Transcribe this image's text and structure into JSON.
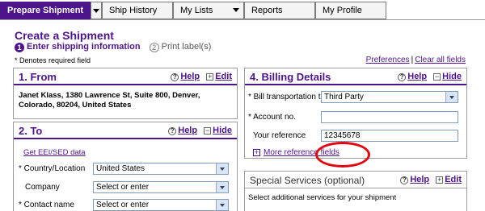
{
  "tabs": [
    {
      "label": "Prepare Shipment"
    },
    {
      "label": "Ship History"
    },
    {
      "label": "My Lists"
    },
    {
      "label": "Reports"
    },
    {
      "label": "My Profile"
    }
  ],
  "page": {
    "title": "Create a Shipment",
    "steps": [
      {
        "num": "1",
        "label": "Enter shipping information"
      },
      {
        "num": "2",
        "label": "Print label(s)"
      }
    ],
    "required_note": "* Denotes required field",
    "preferences_link": "Preferences",
    "separator": "|",
    "clear_all_link": "Clear all fields"
  },
  "from_panel": {
    "title": "1. From",
    "help": "Help",
    "edit": "Edit",
    "address": "Janet Klass, 1380 Lawrence St, Suite 800, Denver, Colorado, 80204, United States"
  },
  "to_panel": {
    "title": "2. To",
    "help": "Help",
    "hide": "Hide",
    "eei_link": "Get EEI/SED data",
    "country_label": "* Country/Location",
    "country_value": "United States",
    "company_label": "Company",
    "company_value": "Select or enter",
    "contact_label": "* Contact name",
    "contact_value": "Select or enter"
  },
  "billing_panel": {
    "title": "4. Billing Details",
    "help": "Help",
    "hide": "Hide",
    "bill_label": "* Bill transportation to",
    "bill_value": "Third Party",
    "account_label": "* Account no.",
    "account_value": "",
    "reference_label": "Your reference",
    "reference_value": "12345678",
    "more_refs_link": "More reference fields"
  },
  "special_panel": {
    "title": "Special Services (optional)",
    "help": "Help",
    "edit": "Edit",
    "note": "Select additional services for your shipment"
  },
  "colors": {
    "brand_purple": "#4d148c",
    "highlight_red": "#e30613"
  }
}
